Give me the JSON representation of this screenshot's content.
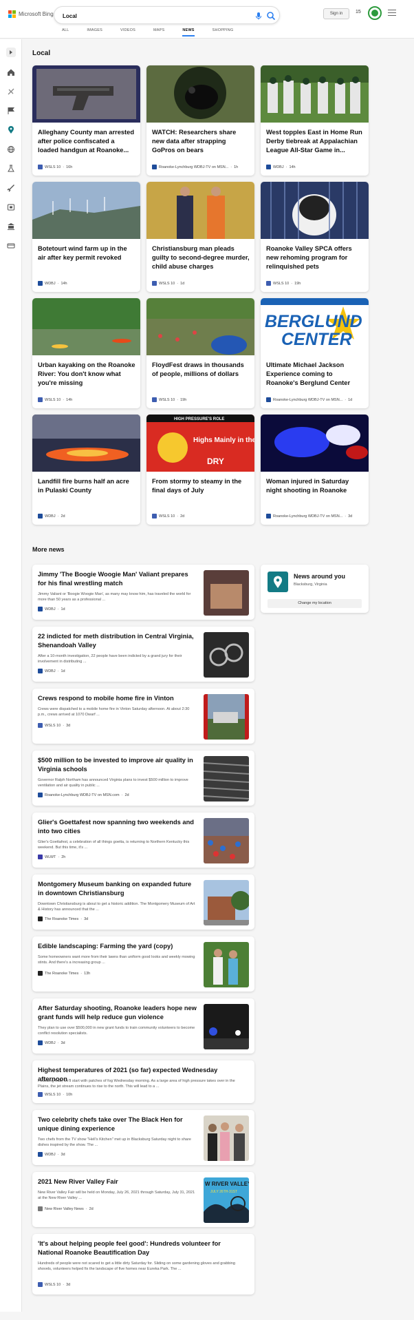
{
  "brand": {
    "name": "Microsoft Bing",
    "accent": "#2b7ff0",
    "logo_colors": [
      "#f25022",
      "#7fba00",
      "#00a4ef",
      "#ffb900"
    ]
  },
  "search": {
    "query": "Local",
    "placeholder": ""
  },
  "header": {
    "sign_in": "Sign in",
    "rewards_count": "15"
  },
  "tabs": [
    "ALL",
    "IMAGES",
    "VIDEOS",
    "MAPS",
    "NEWS",
    "SHOPPING"
  ],
  "active_tab": "NEWS",
  "sidebar_icons": [
    "expand-arrow-icon",
    "home-icon",
    "sports-icon",
    "flag-icon",
    "location-icon",
    "globe-icon",
    "science-icon",
    "rocket-icon",
    "entertainment-icon",
    "bank-icon",
    "money-icon"
  ],
  "local": {
    "title": "Local",
    "cards": [
      {
        "title": "Alleghany County man arrested after police confiscated a loaded handgun at Roanoke...",
        "source": "WSLS 10",
        "time": "16h"
      },
      {
        "title": "WATCH: Researchers share new data after strapping GoPros on bears",
        "source": "Roanoke-Lynchburg WDBJ-TV on MSN...",
        "time": "1h"
      },
      {
        "title": "West topples East in Home Run Derby tiebreak at Appalachian League All-Star Game in...",
        "source": "WDBJ",
        "time": "14h"
      },
      {
        "title": "Botetourt wind farm up in the air after key permit revoked",
        "source": "WDBJ",
        "time": "14h"
      },
      {
        "title": "Christiansburg man pleads guilty to second-degree murder, child abuse charges",
        "source": "WSLS 10",
        "time": "1d"
      },
      {
        "title": "Roanoke Valley SPCA offers new rehoming program for relinquished pets",
        "source": "WSLS 10",
        "time": "19h"
      },
      {
        "title": "Urban kayaking on the Roanoke River: You don't know what you're missing",
        "source": "WSLS 10",
        "time": "14h"
      },
      {
        "title": "FloydFest draws in thousands of people, millions of dollars",
        "source": "WSLS 10",
        "time": "19h"
      },
      {
        "title": "Ultimate Michael Jackson Experience coming to Roanoke's Berglund Center",
        "source": "Roanoke-Lynchburg WDBJ-TV on MSN...",
        "time": "1d"
      },
      {
        "title": "Landfill fire burns half an acre in Pulaski County",
        "source": "WDBJ",
        "time": "2d"
      },
      {
        "title": "From stormy to steamy in the final days of July",
        "source": "WSLS 10",
        "time": "2d"
      },
      {
        "title": "Woman injured in Saturday night shooting in Roanoke",
        "source": "Roanoke-Lynchburg WDBJ-TV on MSN...",
        "time": "3d"
      }
    ],
    "image_texts": {
      "berglund_line1": "BERGLUND",
      "berglund_line2": "CENTER",
      "weather_top": "HIGH PRESSURE'S ROLE",
      "weather_main": "Highs Mainly in the 90s",
      "weather_dry": "DRY"
    }
  },
  "more": {
    "title": "More news",
    "items": [
      {
        "title": "Jimmy 'The Boogie Woogie Man' Valiant prepares for his final wrestling match",
        "snippet": "Jimmy Valiant or 'Boogie Woogie Man', as many may know him, has traveled the world for more than 50 years as a professional ...",
        "source": "WDBJ",
        "time": "1d"
      },
      {
        "title": "22 indicted for meth distribution in Central Virginia, Shenandoah Valley",
        "snippet": "After a 10-month investigation, 22 people have been indicted by a grand jury for their involvement in distributing ...",
        "source": "WDBJ",
        "time": "1d"
      },
      {
        "title": "Crews respond to mobile home fire in Vinton",
        "snippet": "Crews were dispatched to a mobile home fire in Vinton Saturday afternoon. At about 2:30 p.m., crews arrived at 1070 Dwarf ...",
        "source": "WSLS 10",
        "time": "3d"
      },
      {
        "title": "$500 million to be invested to improve air quality in Virginia schools",
        "snippet": "Governor Ralph Northam has announced Virginia plans to invest $500 million to improve ventilation and air quality in public ...",
        "source": "Roanoke-Lynchburg WDBJ-TV on MSN.com",
        "time": "2d"
      },
      {
        "title": "Glier's Goettafest now spanning two weekends and into two cities",
        "snippet": "Glier's Goettafest, a celebration of all things goetta, is returning to Northern Kentucky this weekend. But this time, it's ...",
        "source": "WLWT",
        "time": "2h"
      },
      {
        "title": "Montgomery Museum banking on expanded future in downtown Christiansburg",
        "snippet": "Downtown Christiansburg is about to get a historic addition. The Montgomery Museum of Art & History has announced that the ...",
        "source": "The Roanoke Times",
        "time": "3d"
      },
      {
        "title": "Edible landscaping: Farming the yard (copy)",
        "snippet": "Some homeowners want more from their lawns than uniform good looks and weekly mowing stints. And there's a increasing group ...",
        "source": "The Roanoke Times",
        "time": "13h"
      },
      {
        "title": "After Saturday shooting, Roanoke leaders hope new grant funds will help reduce gun violence",
        "snippet": "They plan to use over $500,000 in new grant funds to train community volunteers to become conflict resolution specialists.",
        "source": "WDBJ",
        "time": "3d"
      },
      {
        "title": "Highest temperatures of 2021 (so far) expected Wednesday afternoon",
        "snippet": "Following that, we'll start with patches of fog Wednesday morning. As a large area of high pressure takes over in the Plains, the jet stream continues to rise to the north. This will lead to a ...",
        "source": "WSLS 10",
        "time": "10h"
      },
      {
        "title": "Two celebrity chefs take over The Black Hen for unique dining experience",
        "snippet": "Two chefs from the TV show \"Hell's Kitchen\" met up in Blacksburg Saturday night to share dishes inspired by the show. The ...",
        "source": "WDBJ",
        "time": "3d"
      },
      {
        "title": "2021 New River Valley Fair",
        "snippet": "New River Valley Fair will be held on Monday, July 26, 2021 through Saturday, July 31, 2021 at the New River Valley ...",
        "source": "New River Valley News",
        "time": "2d"
      },
      {
        "title": "'It's about helping people feel good': Hundreds volunteer for National Roanoke Beautification Day",
        "snippet": "Hundreds of people were not scared to get a little dirty Saturday for. Sliding on some gardening gloves and grabbing shovels, volunteers helped fix the landscape of five homes near Eureka Park. The ...",
        "source": "WSLS 10",
        "time": "3d"
      }
    ],
    "fair_thumb_text": "W RIVER VALLEY F",
    "fair_thumb_date": "JULY 26TH-31ST"
  },
  "news_around": {
    "title": "News around you",
    "location": "Blacksburg, Virginia",
    "button": "Change my location"
  }
}
